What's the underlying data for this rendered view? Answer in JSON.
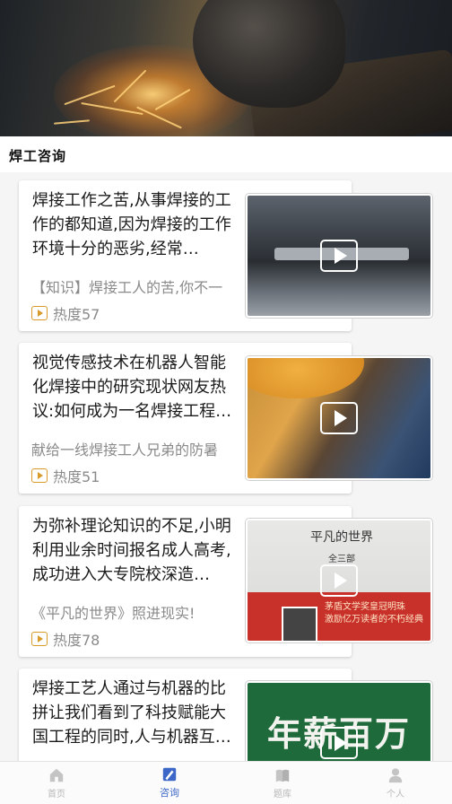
{
  "section": {
    "title": "焊工咨询"
  },
  "articles": [
    {
      "title": "焊接工作之苦,从事焊接的工作的都知道,因为焊接的工作环境十分的恶劣,经常…",
      "summary": "【知识】焊接工人的苦,你不一",
      "heat": "热度57"
    },
    {
      "title": "视觉传感技术在机器人智能化焊接中的研究现状网友热议:如何成为一名焊接工程…",
      "summary": "献给一线焊接工人兄弟的防暑",
      "heat": "热度51"
    },
    {
      "title": "为弥补理论知识的不足,小明利用业余时间报名成人高考,成功进入大专院校深造…",
      "summary": "《平凡的世界》照进现实!",
      "heat": "热度78",
      "thumb_text": {
        "book_title": "平凡的世界",
        "book_sub": "全三部",
        "line1": "茅盾文学奖皇冠明珠",
        "line2": "激励亿万读者的不朽经典"
      }
    },
    {
      "title": "焊接工艺人通过与机器的比拼让我们看到了科技赋能大国工程的同时,人与机器互…",
      "thumb_text": {
        "big": "年薪百万"
      }
    }
  ],
  "nav": [
    {
      "label": "首页",
      "icon": "home-icon"
    },
    {
      "label": "咨询",
      "icon": "consult-icon",
      "active": true
    },
    {
      "label": "题库",
      "icon": "book-icon"
    },
    {
      "label": "个人",
      "icon": "person-icon"
    }
  ],
  "colors": {
    "active": "#3c66c8",
    "inactive": "#b8b8b8",
    "heat_icon": "#d89a2a"
  }
}
